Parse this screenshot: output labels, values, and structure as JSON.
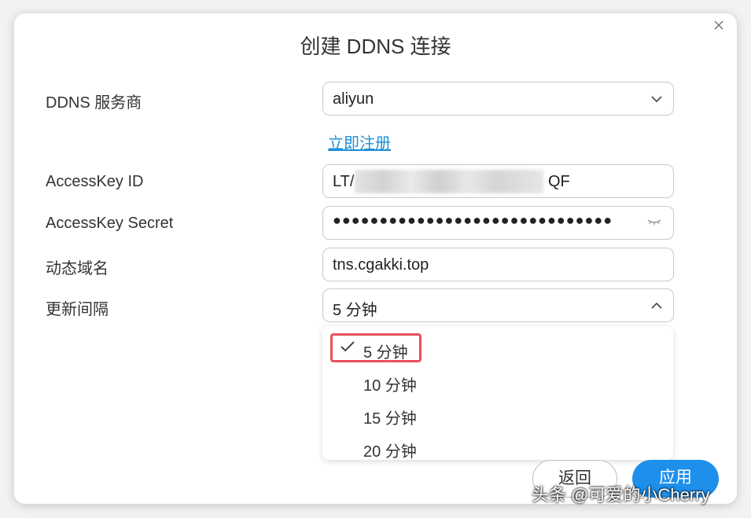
{
  "dialog": {
    "title": "创建 DDNS 连接"
  },
  "form": {
    "provider_label": "DDNS 服务商",
    "provider_value": "aliyun",
    "register_link": "立即注册",
    "accesskey_id_label": "AccessKey ID",
    "accesskey_id_prefix": "LT/",
    "accesskey_id_suffix": "QF",
    "accesskey_secret_label": "AccessKey Secret",
    "accesskey_secret_value": "●●●●●●●●●●●●●●●●●●●●●●●●●●●●●●",
    "domain_label": "动态域名",
    "domain_value": "tns.cgakki.top",
    "interval_label": "更新间隔",
    "interval_value": "5 分钟"
  },
  "interval_options": [
    "5 分钟",
    "10 分钟",
    "15 分钟",
    "20 分钟"
  ],
  "buttons": {
    "back": "返回",
    "apply": "应用"
  },
  "watermark": "头条 @可爱的小Cherry",
  "icons": {
    "close": "close-icon",
    "chevron_down": "chevron-down-icon",
    "chevron_up": "chevron-up-icon",
    "eye_closed": "eye-closed-icon",
    "check": "check-icon"
  },
  "colors": {
    "accent": "#1e90ec",
    "link": "#1a8fd8",
    "highlight": "#e8505b"
  }
}
